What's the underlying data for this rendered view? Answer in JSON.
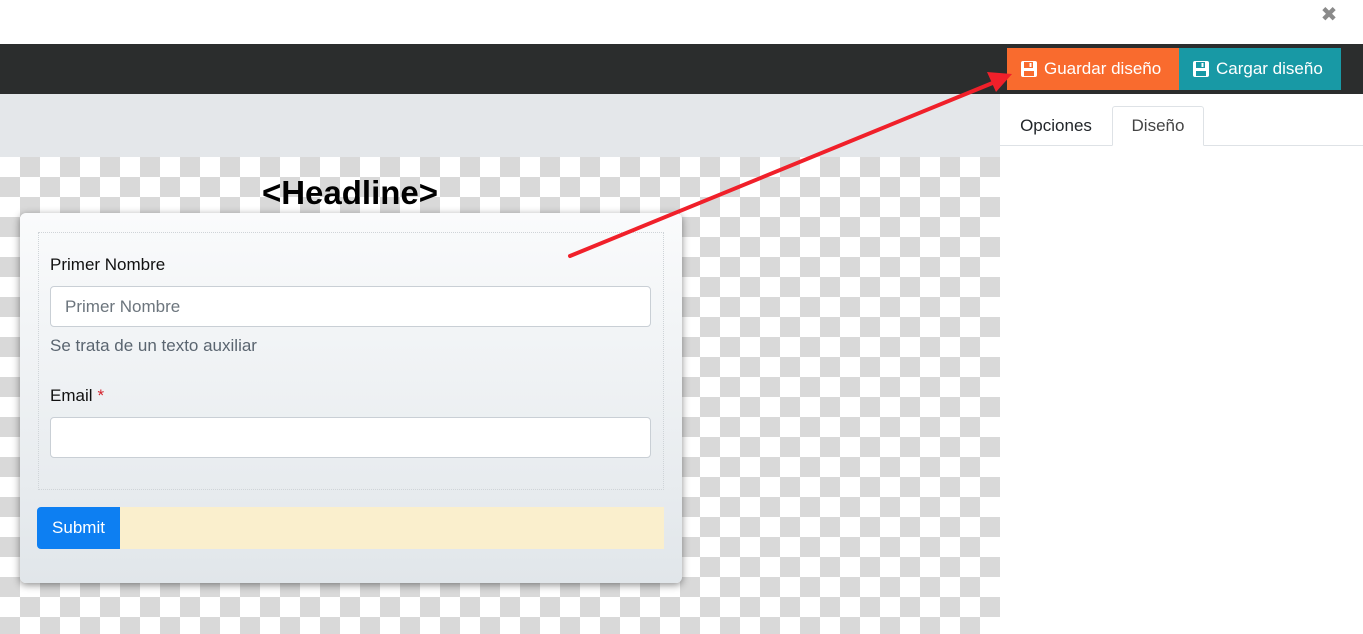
{
  "window": {
    "close_glyph": "✖"
  },
  "toolbar": {
    "save_label": "Guardar diseño",
    "load_label": "Cargar diseño",
    "save_icon": "save-icon",
    "load_icon": "save-icon",
    "save_color": "#f96b2e",
    "load_color": "#1899a5"
  },
  "side_panel": {
    "tabs": [
      {
        "label": "Opciones",
        "active": false
      },
      {
        "label": "Diseño",
        "active": true
      }
    ]
  },
  "form_preview": {
    "headline": "<Headline>",
    "fields": [
      {
        "label": "Primer Nombre",
        "placeholder": "Primer Nombre",
        "help": "Se trata de un texto auxiliar",
        "required": false
      },
      {
        "label": "Email",
        "placeholder": "",
        "required": true,
        "required_mark": "*"
      }
    ],
    "submit_label": "Submit"
  },
  "annotation": {
    "color": "#f0202a",
    "icon": "red-arrow"
  }
}
